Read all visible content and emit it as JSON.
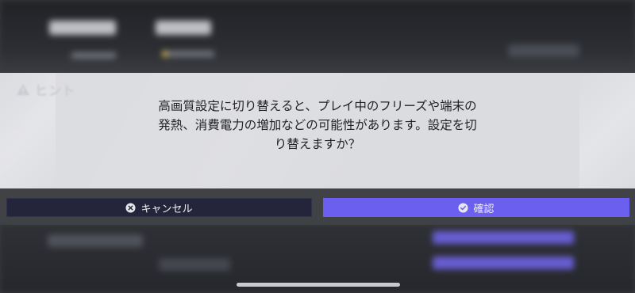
{
  "dialog": {
    "header": {
      "icon": "warning-icon",
      "label": "ヒント"
    },
    "message_lines": [
      "高画質設定に切り替えると、プレイ中のフリーズや端末の",
      "発熱、消費電力の増加などの可能性があります。設定を切",
      "り替えますか？"
    ],
    "buttons": {
      "cancel": {
        "label": "キャンセル",
        "icon": "close-circle-icon"
      },
      "confirm": {
        "label": "確認",
        "icon": "check-circle-icon"
      }
    }
  },
  "colors": {
    "panel": "#e4e5e9",
    "cancel_button": "#24253a",
    "confirm_button": "#6b5ff0",
    "text": "#222327",
    "button_text": "#f1f2f5"
  }
}
